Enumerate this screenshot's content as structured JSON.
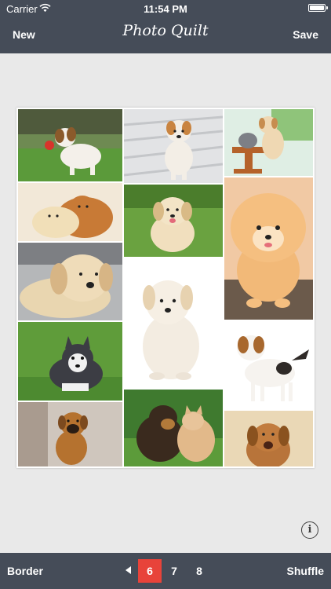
{
  "status_bar": {
    "carrier": "Carrier",
    "time": "11:54 PM"
  },
  "nav": {
    "left_button": "New",
    "title": "Photo Quilt",
    "right_button": "Save"
  },
  "collage": {
    "photos": [
      "puppy-with-red-ball",
      "puppy-on-wooden-deck",
      "puppy-with-kitten-on-stool",
      "two-sleeping-puppies",
      "puppy-on-grass",
      "fluffy-pomeranian",
      "puppy-lying-down",
      "white-puppy-sitting",
      "husky-puppy-on-grass",
      "jack-russell-puppy",
      "boxer-puppy",
      "puppy-and-kitten",
      "puppy-on-sand"
    ]
  },
  "bottom_bar": {
    "left_button": "Border",
    "right_button": "Shuffle",
    "photo_counts": [
      "6",
      "7",
      "8"
    ],
    "selected_count": "6"
  },
  "colors": {
    "bar_background": "#454c58",
    "selected_accent": "#e8433a",
    "canvas_background": "#e9e9e9"
  }
}
